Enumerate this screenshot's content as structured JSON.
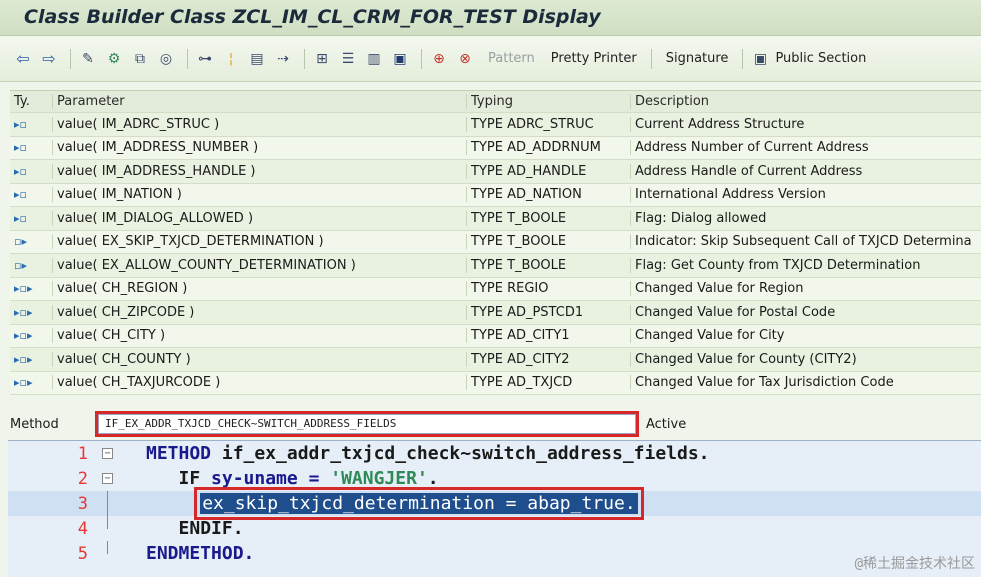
{
  "window": {
    "title": "Class Builder Class ZCL_IM_CL_CRM_FOR_TEST Display"
  },
  "toolbar": {
    "icons": [
      "back-arrow-icon",
      "forward-arrow-icon",
      "other-object-icon",
      "display-change-icon",
      "activate-icon",
      "check-icon",
      "where-used-icon",
      "object-list-icon",
      "navigate-icon",
      "hierarchy-icon",
      "dependency-icon",
      "layout-icon",
      "info-icon",
      "find-icon",
      "find-next-icon"
    ],
    "pattern_label": "Pattern",
    "pretty_printer_label": "Pretty Printer",
    "signature_label": "Signature",
    "public_section_label": "Public Section"
  },
  "params": {
    "headers": {
      "type": "Ty.",
      "parameter": "Parameter",
      "typing": "Typing",
      "description": "Description"
    },
    "rows": [
      {
        "dir": "import",
        "parameter": "value( IM_ADRC_STRUC )",
        "typing": "TYPE ADRC_STRUC",
        "description": "Current Address Structure"
      },
      {
        "dir": "import",
        "parameter": "value( IM_ADDRESS_NUMBER )",
        "typing": "TYPE AD_ADDRNUM",
        "description": "Address Number of Current Address"
      },
      {
        "dir": "import",
        "parameter": "value( IM_ADDRESS_HANDLE )",
        "typing": "TYPE AD_HANDLE",
        "description": "Address Handle of Current Address"
      },
      {
        "dir": "import",
        "parameter": "value( IM_NATION )",
        "typing": "TYPE AD_NATION",
        "description": "International Address Version"
      },
      {
        "dir": "import",
        "parameter": "value( IM_DIALOG_ALLOWED )",
        "typing": "TYPE T_BOOLE",
        "description": "Flag: Dialog allowed"
      },
      {
        "dir": "export",
        "parameter": "value( EX_SKIP_TXJCD_DETERMINATION )",
        "typing": "TYPE T_BOOLE",
        "description": "Indicator: Skip Subsequent Call of TXJCD Determina"
      },
      {
        "dir": "export",
        "parameter": "value( EX_ALLOW_COUNTY_DETERMINATION )",
        "typing": "TYPE T_BOOLE",
        "description": "Flag: Get County from TXJCD Determination"
      },
      {
        "dir": "changing",
        "parameter": "value( CH_REGION )",
        "typing": "TYPE REGIO",
        "description": "Changed Value for Region"
      },
      {
        "dir": "changing",
        "parameter": "value( CH_ZIPCODE )",
        "typing": "TYPE AD_PSTCD1",
        "description": "Changed Value for Postal Code"
      },
      {
        "dir": "changing",
        "parameter": "value( CH_CITY )",
        "typing": "TYPE AD_CITY1",
        "description": "Changed Value for City"
      },
      {
        "dir": "changing",
        "parameter": "value( CH_COUNTY )",
        "typing": "TYPE AD_CITY2",
        "description": "Changed Value for County (CITY2)"
      },
      {
        "dir": "changing",
        "parameter": "value( CH_TAXJURCODE )",
        "typing": "TYPE AD_TXJCD",
        "description": "Changed Value for Tax Jurisdiction Code"
      }
    ]
  },
  "method": {
    "label": "Method",
    "value": "IF_EX_ADDR_TXJCD_CHECK~SWITCH_ADDRESS_FIELDS",
    "status": "Active"
  },
  "editor": {
    "lines": [
      {
        "num": "1",
        "kw1": "METHOD ",
        "rest": "if_ex_addr_txjcd_check~switch_address_fields."
      },
      {
        "num": "2",
        "kw1": "IF ",
        "rest1": "sy-uname = ",
        "str": "'WANGJER'",
        "rest2": "."
      },
      {
        "num": "3",
        "sel": "ex_skip_txjcd_determination = abap_true."
      },
      {
        "num": "4",
        "kw1": "ENDIF."
      },
      {
        "num": "5",
        "kw1": "ENDMETHOD."
      }
    ]
  },
  "watermark": "@稀土掘金技术社区"
}
